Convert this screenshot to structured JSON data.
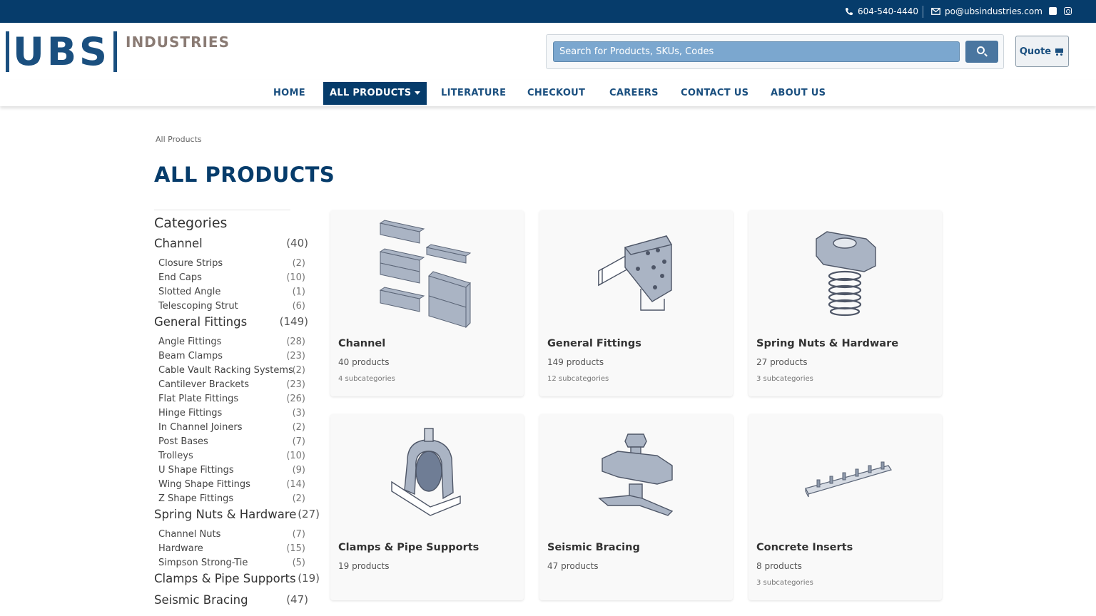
{
  "topbar": {
    "phone": "604-540-4440",
    "email": "po@ubsindustries.com"
  },
  "header": {
    "logo_main": "UBS",
    "logo_sub": "INDUSTRIES",
    "search_placeholder": "Search for Products, SKUs, Codes",
    "quote_label": "Quote"
  },
  "nav": {
    "home": "HOME",
    "all_products": "ALL PRODUCTS",
    "literature": "LITERATURE",
    "checkout": "CHECKOUT",
    "careers": "CAREERS",
    "contact": "CONTACT US",
    "about": "ABOUT US"
  },
  "breadcrumb": "All Products",
  "page_title": "ALL PRODUCTS",
  "sidebar": {
    "heading": "Categories",
    "categories": [
      {
        "label": "Channel",
        "count": "(40)",
        "subs": [
          {
            "label": "Closure Strips",
            "count": "(2)"
          },
          {
            "label": "End Caps",
            "count": "(10)"
          },
          {
            "label": "Slotted Angle",
            "count": "(1)"
          },
          {
            "label": "Telescoping Strut",
            "count": "(6)"
          }
        ]
      },
      {
        "label": "General Fittings",
        "count": "(149)",
        "subs": [
          {
            "label": "Angle Fittings",
            "count": "(28)"
          },
          {
            "label": "Beam Clamps",
            "count": "(23)"
          },
          {
            "label": "Cable Vault Racking Systems",
            "count": "(2)"
          },
          {
            "label": "Cantilever Brackets",
            "count": "(23)"
          },
          {
            "label": "Flat Plate Fittings",
            "count": "(26)"
          },
          {
            "label": "Hinge Fittings",
            "count": "(3)"
          },
          {
            "label": "In Channel Joiners",
            "count": "(2)"
          },
          {
            "label": "Post Bases",
            "count": "(7)"
          },
          {
            "label": "Trolleys",
            "count": "(10)"
          },
          {
            "label": "U Shape Fittings",
            "count": "(9)"
          },
          {
            "label": "Wing Shape Fittings",
            "count": "(14)"
          },
          {
            "label": "Z Shape Fittings",
            "count": "(2)"
          }
        ]
      },
      {
        "label": "Spring Nuts & Hardware",
        "count": "(27)",
        "subs": [
          {
            "label": "Channel Nuts",
            "count": "(7)"
          },
          {
            "label": "Hardware",
            "count": "(15)"
          },
          {
            "label": "Simpson Strong-Tie",
            "count": "(5)"
          }
        ]
      },
      {
        "label": "Clamps & Pipe Supports",
        "count": "(19)",
        "subs": []
      },
      {
        "label": "Seismic Bracing",
        "count": "(47)",
        "subs": []
      }
    ]
  },
  "cards": [
    {
      "name": "Channel",
      "products": "40 products",
      "subs": "4 subcategories",
      "icon": "channel-icon"
    },
    {
      "name": "General Fittings",
      "products": "149 products",
      "subs": "12 subcategories",
      "icon": "general-fittings-icon"
    },
    {
      "name": "Spring Nuts & Hardware",
      "products": "27 products",
      "subs": "3 subcategories",
      "icon": "spring-nut-icon"
    },
    {
      "name": "Clamps & Pipe Supports",
      "products": "19 products",
      "subs": "",
      "icon": "pipe-clamp-icon"
    },
    {
      "name": "Seismic Bracing",
      "products": "47 products",
      "subs": "",
      "icon": "seismic-bracing-icon"
    },
    {
      "name": "Concrete Inserts",
      "products": "8 products",
      "subs": "3 subcategories",
      "icon": "concrete-insert-icon"
    }
  ],
  "colors": {
    "brand": "#063c6b",
    "accent": "#1a4f7f",
    "search_bg": "#7ba7cf"
  }
}
